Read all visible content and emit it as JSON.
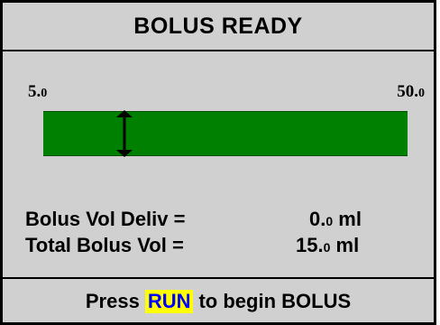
{
  "header": {
    "title": "BOLUS READY"
  },
  "scale": {
    "min_main": "5.",
    "min_dec": "0",
    "max_main": "50.",
    "max_dec": "0",
    "level": 0.222
  },
  "readouts": {
    "bolus_vol_deliv": {
      "label": "Bolus Vol Deliv =",
      "value_main": "0.",
      "value_dec": "0",
      "unit": " ml"
    },
    "total_bolus_vol": {
      "label": "Total Bolus Vol =",
      "value_main": "15.",
      "value_dec": "0",
      "unit": " ml"
    }
  },
  "footer": {
    "prefix": "Press",
    "key": "RUN",
    "suffix": "to begin BOLUS"
  },
  "colors": {
    "bar": "#008000",
    "background": "#d0d0d0",
    "key_highlight": "#ffff00",
    "key_text": "#0000ff"
  },
  "icons": {
    "level_marker": "double-arrow-vertical-icon"
  }
}
